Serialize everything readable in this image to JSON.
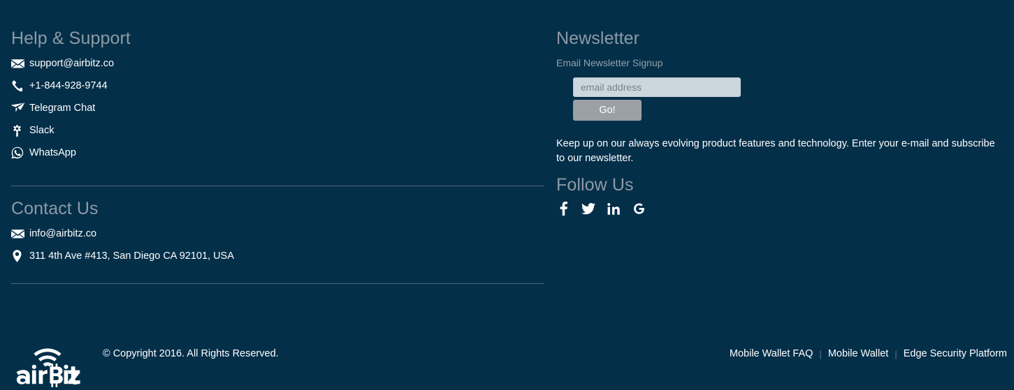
{
  "theme": {
    "background": "#042f49",
    "heading_color": "#8d9aa5",
    "text_color": "#ffffff",
    "divider_color": "#5c7486",
    "input_background": "#ccd6dd",
    "button_background": "#9aa0a5"
  },
  "help": {
    "heading": "Help & Support",
    "items": [
      {
        "icon": "envelope-icon",
        "label": "support@airbitz.co"
      },
      {
        "icon": "phone-icon",
        "label": "+1-844-928-9744"
      },
      {
        "icon": "telegram-icon",
        "label": "Telegram Chat"
      },
      {
        "icon": "slack-icon",
        "label": "Slack"
      },
      {
        "icon": "whatsapp-icon",
        "label": "WhatsApp"
      }
    ]
  },
  "contact": {
    "heading": "Contact Us",
    "items": [
      {
        "icon": "envelope-icon",
        "label": "info@airbitz.co"
      },
      {
        "icon": "map-pin-icon",
        "label": "311 4th Ave #413, San Diego CA 92101, USA"
      }
    ]
  },
  "newsletter": {
    "heading": "Newsletter",
    "sub_label": "Email Newsletter Signup",
    "email_placeholder": "email address",
    "email_value": "",
    "submit_label": "Go!",
    "blurb": "Keep up on our always evolving product features and technology. Enter your e-mail and subscribe to our newsletter."
  },
  "follow": {
    "heading": "Follow Us",
    "icons": [
      {
        "name": "facebook-icon",
        "label": "Facebook"
      },
      {
        "name": "twitter-icon",
        "label": "Twitter"
      },
      {
        "name": "linkedin-icon",
        "label": "LinkedIn"
      },
      {
        "name": "google-icon",
        "label": "Google"
      }
    ]
  },
  "bottom": {
    "logo_text": "airBitz",
    "copyright": "© Copyright 2016. All Rights Reserved.",
    "links": [
      {
        "label": "Mobile Wallet FAQ"
      },
      {
        "label": "Mobile Wallet"
      },
      {
        "label": "Edge Security Platform"
      }
    ],
    "separator": "|"
  }
}
